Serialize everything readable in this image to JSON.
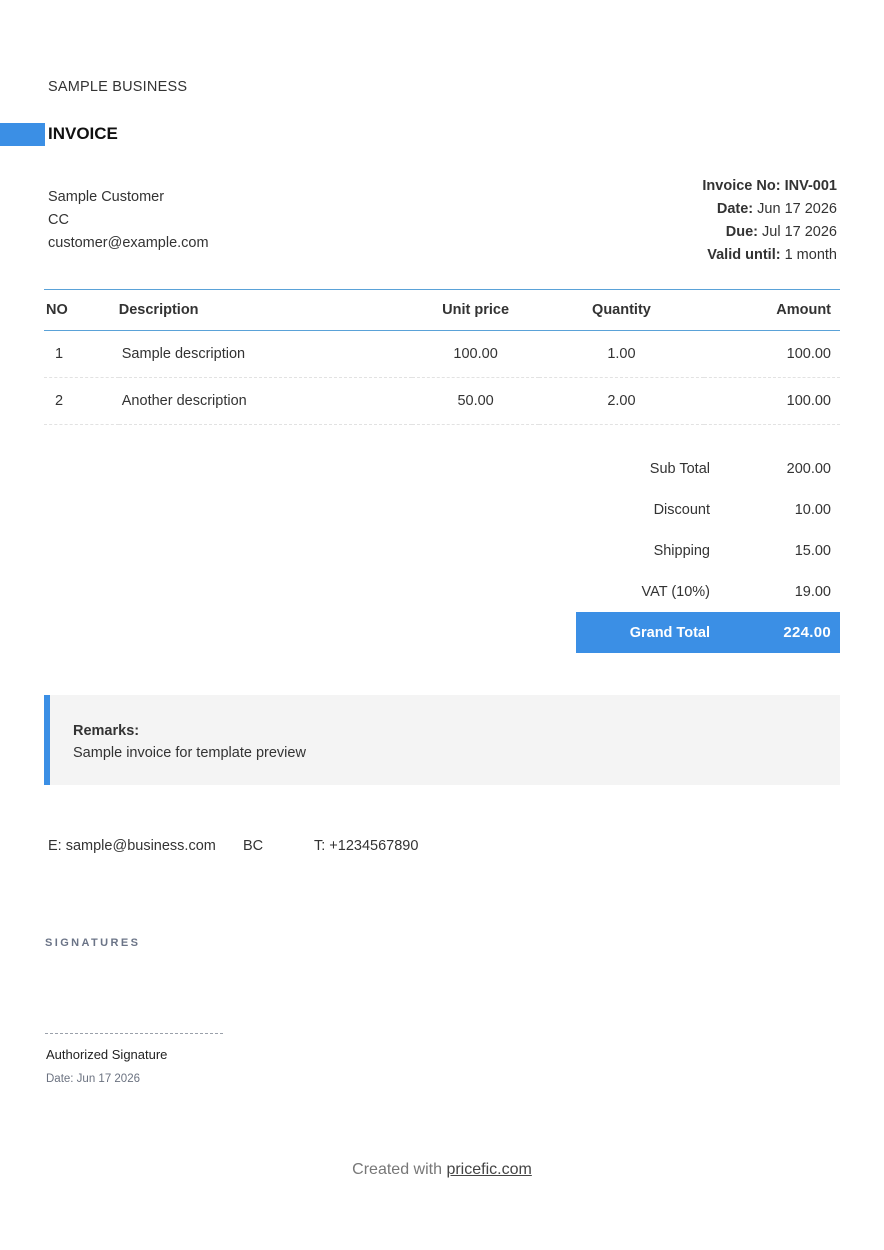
{
  "business": {
    "name": "SAMPLE BUSINESS"
  },
  "document": {
    "title": "INVOICE"
  },
  "customer": {
    "name": "Sample Customer",
    "line2": "CC",
    "email": "customer@example.com"
  },
  "meta": {
    "invoice_no_label": "Invoice No:",
    "invoice_no": "INV-001",
    "date_label": "Date:",
    "date": "Jun 17 2026",
    "due_label": "Due:",
    "due": "Jul 17 2026",
    "valid_label": "Valid until:",
    "valid": "1 month"
  },
  "table": {
    "headers": [
      "NO",
      "Description",
      "Unit price",
      "Quantity",
      "Amount"
    ],
    "rows": [
      {
        "no": "1",
        "description": "Sample description",
        "unit_price": "100.00",
        "quantity": "1.00",
        "amount": "100.00"
      },
      {
        "no": "2",
        "description": "Another description",
        "unit_price": "50.00",
        "quantity": "2.00",
        "amount": "100.00"
      }
    ]
  },
  "totals": {
    "subtotal_label": "Sub Total",
    "subtotal": "200.00",
    "discount_label": "Discount",
    "discount": "10.00",
    "shipping_label": "Shipping",
    "shipping": "15.00",
    "vat_label": "VAT (10%)",
    "vat": "19.00",
    "grand_label": "Grand Total",
    "grand": "224.00"
  },
  "remarks": {
    "label": "Remarks:",
    "text": "Sample invoice for template preview"
  },
  "contact": {
    "email": "E: sample@business.com",
    "code": "BC",
    "phone": "T: +1234567890"
  },
  "signatures": {
    "heading": "SIGNATURES",
    "label": "Authorized Signature",
    "date": "Date: Jun 17 2026"
  },
  "footer": {
    "prefix": "Created with",
    "link": "pricefic.com"
  },
  "colors": {
    "accent": "#3b8fe5",
    "rule": "#5aa2d8"
  }
}
